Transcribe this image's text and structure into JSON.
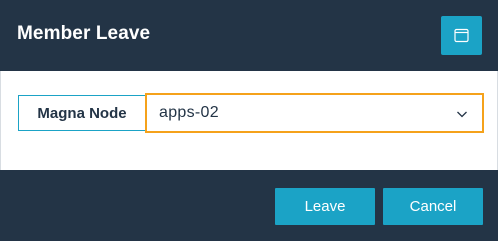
{
  "dialog": {
    "title": "Member Leave",
    "header_button_icon": "window-restore-icon"
  },
  "form": {
    "label": "Magna Node",
    "select_value": "apps-02",
    "select_icon": "chevron-down-icon"
  },
  "footer": {
    "leave_label": "Leave",
    "cancel_label": "Cancel"
  },
  "colors": {
    "header_bg": "#233446",
    "accent": "#1ba3c6",
    "focus": "#f5a21b"
  }
}
